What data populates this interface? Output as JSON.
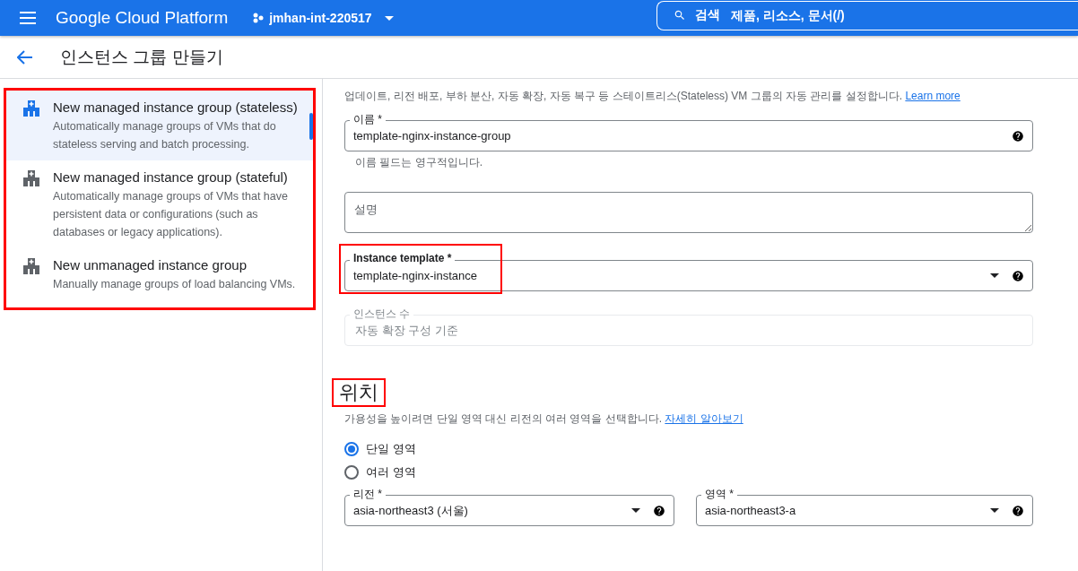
{
  "topbar": {
    "product": "Google Cloud Platform",
    "project": "jmhan-int-220517",
    "search_label": "검색",
    "search_placeholder": "제품, 리소스, 문서(/)"
  },
  "page_title": "인스턴스 그룹 만들기",
  "sidebar": {
    "highlighted": true,
    "items": [
      {
        "title": "New managed instance group (stateless)",
        "description": "Automatically manage groups of VMs that do stateless serving and batch processing.",
        "selected": true
      },
      {
        "title": "New managed instance group (stateful)",
        "description": "Automatically manage groups of VMs that have persistent data or configurations (such as databases or legacy applications).",
        "selected": false
      },
      {
        "title": "New unmanaged instance group",
        "description": "Manually manage groups of load balancing VMs.",
        "selected": false
      }
    ]
  },
  "intro": {
    "text": "업데이트, 리전 배포, 부하 분산, 자동 확장, 자동 복구 등 스테이트리스(Stateless) VM 그룹의 자동 관리를 설정합니다.",
    "link": "Learn more"
  },
  "fields": [
    {
      "kind": "text",
      "label": "이름 *",
      "value": "template-nginx-instance-group",
      "hint": "이름 필드는 영구적입니다."
    },
    {
      "kind": "textarea",
      "placeholder": "설명"
    },
    {
      "kind": "select",
      "label": "Instance template *",
      "value": "template-nginx-instance",
      "highlighted": true
    },
    {
      "kind": "disabled",
      "label": "인스턴스 수",
      "placeholder": "자동 확장 구성 기준"
    }
  ],
  "location": {
    "heading": "위치",
    "highlighted": true,
    "text": "가용성을 높이려면 단일 영역 대신 리전의 여러 영역을 선택합니다.",
    "link": "자세히 알아보기",
    "options": [
      {
        "label": "단일 영역",
        "selected": true
      },
      {
        "label": "여러 영역",
        "selected": false
      }
    ],
    "selects": [
      {
        "label": "리전 *",
        "value": "asia-northeast3 (서울)"
      },
      {
        "label": "영역 *",
        "value": "asia-northeast3-a"
      }
    ]
  }
}
